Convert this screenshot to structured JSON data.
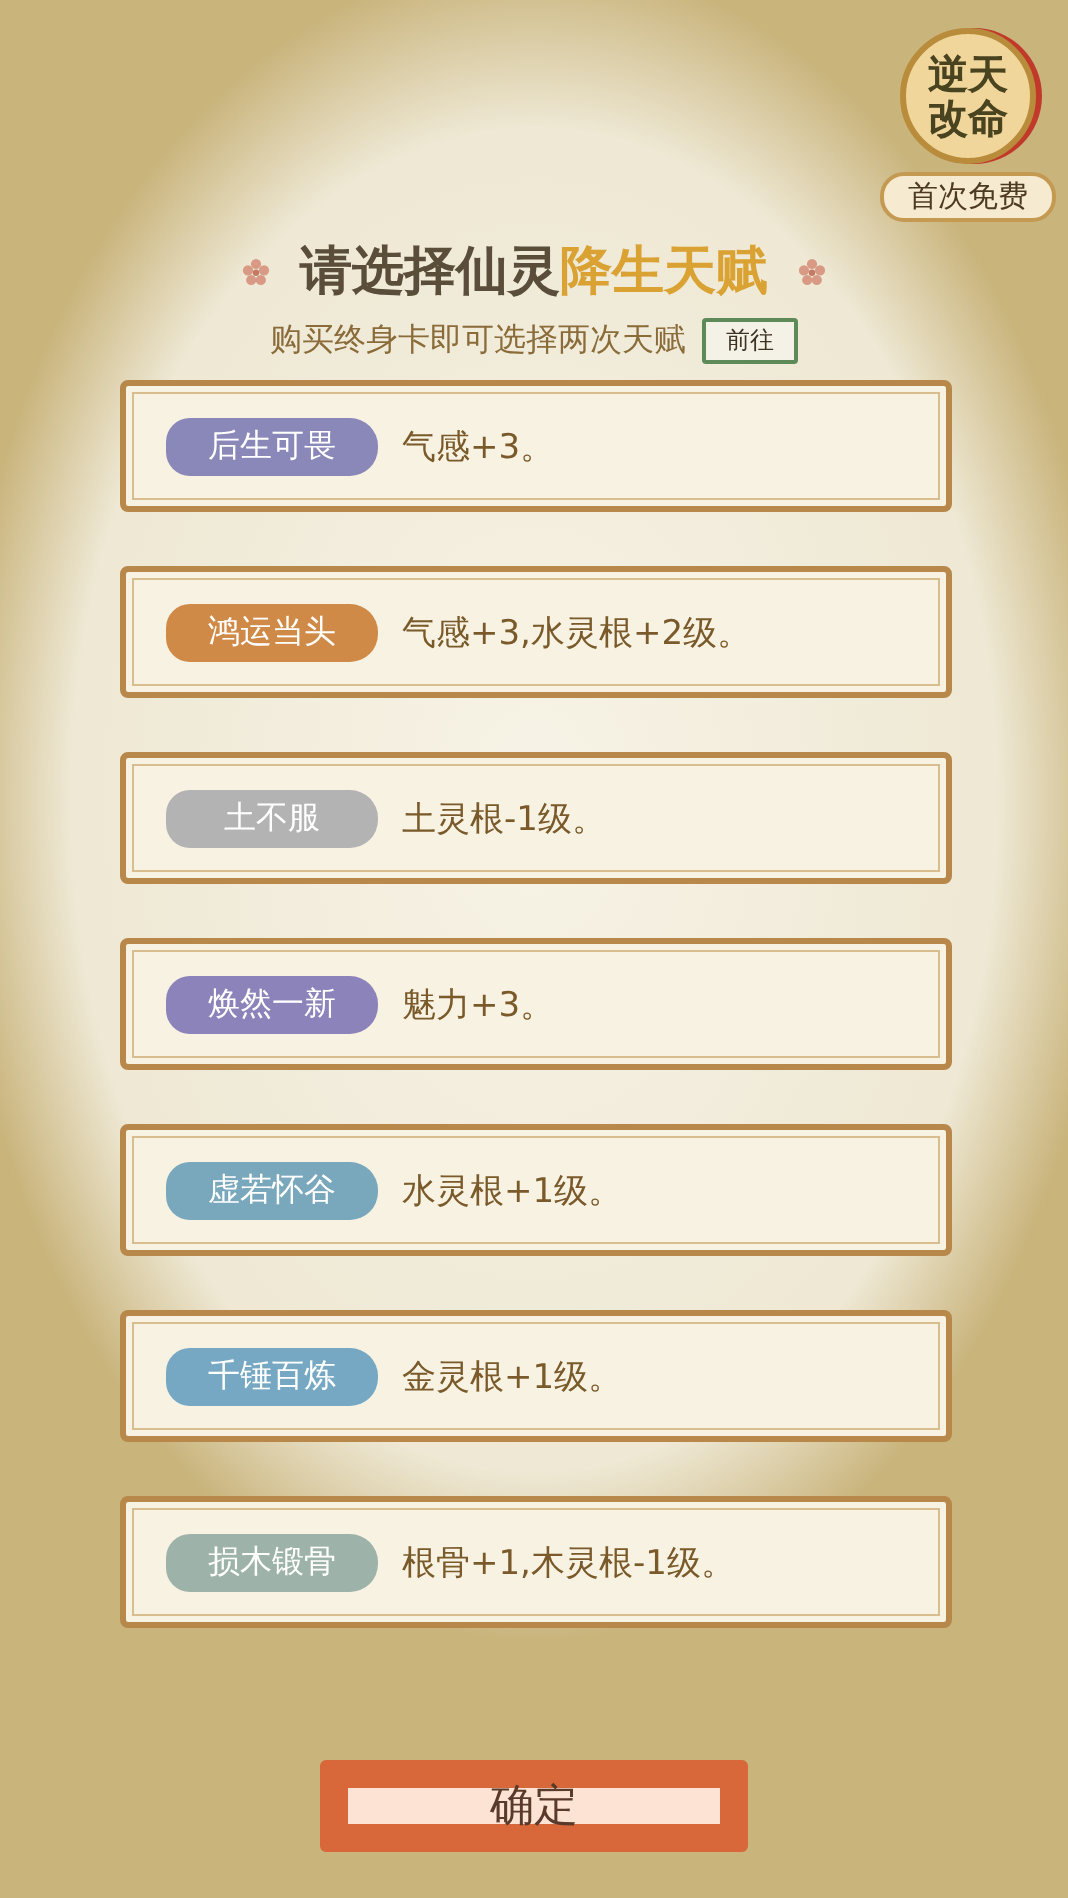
{
  "badge": {
    "title": "逆天改命",
    "caption": "首次免费"
  },
  "header": {
    "title": "请选择仙灵",
    "title_highlight": "降生天赋",
    "subtitle": "购买终身卡即可选择两次天赋",
    "link_button": "前往"
  },
  "talents": [
    {
      "name": "后生可畏",
      "effect": "气感+3。",
      "color": "#8a87b9"
    },
    {
      "name": "鸿运当头",
      "effect": "气感+3,水灵根+2级。",
      "color": "#d08a48"
    },
    {
      "name": "土不服",
      "effect": "土灵根-1级。",
      "color": "#b3b3b3"
    },
    {
      "name": "焕然一新",
      "effect": "魅力+3。",
      "color": "#8b83ba"
    },
    {
      "name": "虚若怀谷",
      "effect": "水灵根+1级。",
      "color": "#79a7bb"
    },
    {
      "name": "千锤百炼",
      "effect": "金灵根+1级。",
      "color": "#76a8c4"
    },
    {
      "name": "损木锻骨",
      "effect": "根骨+1,木灵根-1级。",
      "color": "#9db3a9"
    }
  ],
  "confirm_button": "确定"
}
